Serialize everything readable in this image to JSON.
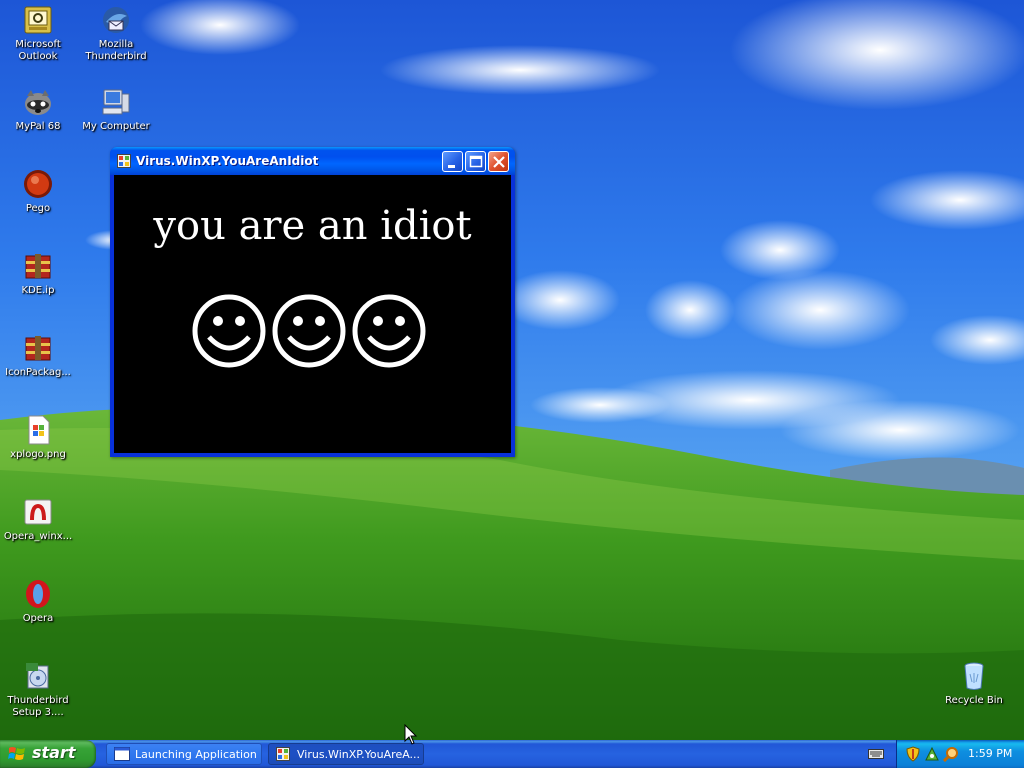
{
  "desktop": {
    "icons": [
      {
        "label": "Microsoft Outlook",
        "icon": "outlook-icon"
      },
      {
        "label": "Mozilla Thunderbird",
        "icon": "thunderbird-icon"
      },
      {
        "label": "MyPal 68",
        "icon": "mypal-icon"
      },
      {
        "label": "My Computer",
        "icon": "my-computer-icon"
      },
      {
        "label": "Pego",
        "icon": "pego-icon"
      },
      {
        "label": "KDE.ip",
        "icon": "winrar-archive-icon"
      },
      {
        "label": "IconPackag...",
        "icon": "winrar-archive-icon"
      },
      {
        "label": "xplogo.png",
        "icon": "png-file-icon"
      },
      {
        "label": "Opera_winx...",
        "icon": "opera-installer-icon"
      },
      {
        "label": "Opera",
        "icon": "opera-icon"
      },
      {
        "label": "Thunderbird Setup 3....",
        "icon": "setup-installer-icon"
      },
      {
        "label": "Recycle Bin",
        "icon": "recycle-bin-icon"
      }
    ]
  },
  "window": {
    "title": "Virus.WinXP.YouAreAnIdiot",
    "message": "you are an idiot",
    "smiley_count": 3
  },
  "taskbar": {
    "start_label": "start",
    "buttons": [
      {
        "label": "Launching Application",
        "icon": "application-window-icon",
        "active": false
      },
      {
        "label": "Virus.WinXP.YouAreA...",
        "icon": "app-window-icon",
        "active": true
      }
    ],
    "tray": {
      "icons": [
        "keyboard-icon",
        "security-shield-icon",
        "network-icon",
        "search-icon"
      ],
      "clock": "1:59 PM"
    }
  },
  "colors": {
    "titlebar": "#0058ee",
    "window_border": "#0831d9",
    "start_green": "#37a337",
    "taskbar_blue": "#2663e0",
    "tray_blue": "#0e8fe0",
    "close_red": "#e0532f"
  }
}
